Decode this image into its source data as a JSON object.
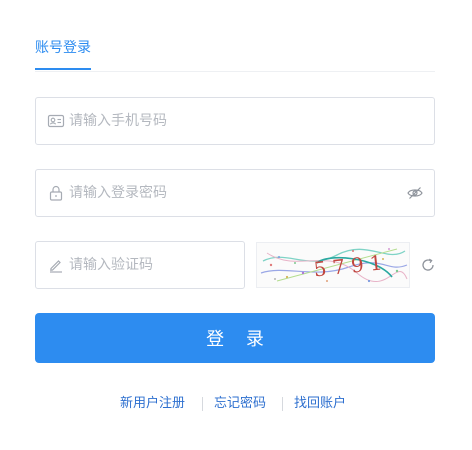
{
  "tabs": {
    "active": "账号登录"
  },
  "form": {
    "phone_placeholder": "请输入手机号码",
    "password_placeholder": "请输入登录密码",
    "code_placeholder": "请输入验证码",
    "captcha_text": "5791"
  },
  "actions": {
    "login_label": "登 录"
  },
  "links": {
    "register": "新用户注册",
    "forgot": "忘记密码",
    "recover": "找回账户"
  },
  "colors": {
    "primary": "#2d8cf0",
    "link": "#2d6fcf",
    "border": "#dcdfe6",
    "placeholder": "#b4b8bf"
  },
  "icons": [
    "id-card-icon",
    "lock-icon",
    "eye-off-icon",
    "pencil-icon",
    "refresh-icon"
  ]
}
